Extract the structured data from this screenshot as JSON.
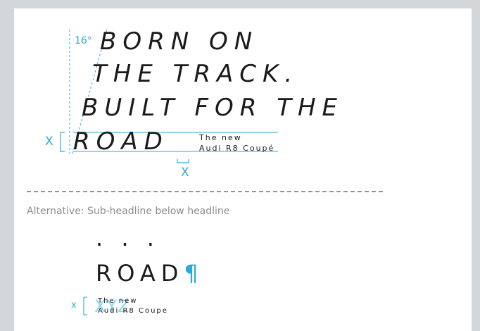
{
  "angle_label": "16°",
  "headline": {
    "line1": "BORN ON",
    "line2": "THE TRACK.",
    "line3": "BUILT FOR THE",
    "line4": "ROAD"
  },
  "subheadline": {
    "line1": "The new",
    "line2": "Audi R8 Coupé"
  },
  "x_label": "X",
  "caption": "Alternative: Sub-headline below headline",
  "alt": {
    "ellipsis": ". . .",
    "road": "ROAD",
    "pilcrow": "¶",
    "x_label": "x",
    "sub_line1": "The new",
    "sub_line2": "Audi R8 Coupe",
    "overlay_letters": "XYZ"
  },
  "colors": {
    "guide": "#2aa9d6",
    "text": "#1a1a1a",
    "caption": "#8c8c8c",
    "background": "#d3d7da",
    "sheet": "#ffffff"
  }
}
